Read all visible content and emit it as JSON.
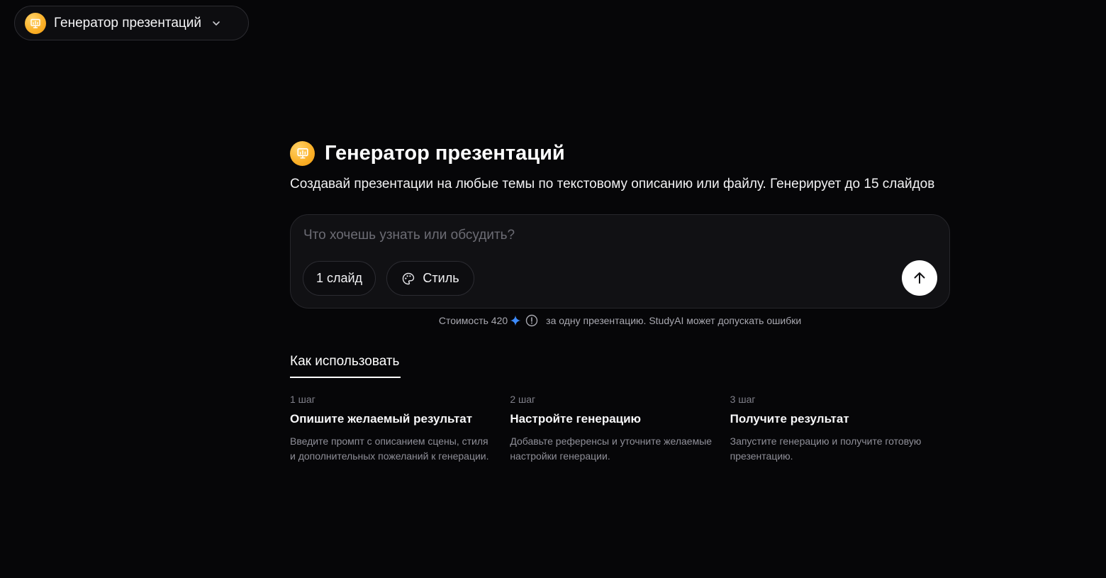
{
  "header": {
    "tool_name": "Генератор презентаций",
    "app_icon": "presentation-icon",
    "dropdown_icon": "chevron-down-icon"
  },
  "hero": {
    "title": "Генератор презентаций",
    "subtitle": "Создавай презентации на любые темы по текстовому описанию или файлу. Генерирует до 15 слайдов"
  },
  "composer": {
    "placeholder": "Что хочешь узнать или обсудить?",
    "slides_label": "1 слайд",
    "style_label": "Стиль",
    "style_icon": "palette-icon",
    "send_icon": "arrow-up-icon"
  },
  "cost": {
    "prefix": "Стоимость 420",
    "currency_icon": "sparkle-icon",
    "info_icon": "info-icon",
    "suffix": "за одну презентацию. StudyAI может допускать ошибки"
  },
  "howto": {
    "tab_label": "Как использовать",
    "steps": [
      {
        "number": "1 шаг",
        "title": "Опишите желаемый результат",
        "description": "Введите промпт с описанием сцены, стиля и дополнительных пожеланий к генерации."
      },
      {
        "number": "2 шаг",
        "title": "Настройте генерацию",
        "description": "Добавьте референсы и уточните желаемые настройки генерации."
      },
      {
        "number": "3 шаг",
        "title": "Получите результат",
        "description": "Запустите генерацию и получите готовую презентацию."
      }
    ]
  },
  "colors": {
    "background": "#060608",
    "accent_icon": "#fbb22a",
    "sparkle": "#3d8bfd",
    "send_button": "#ffffff"
  }
}
